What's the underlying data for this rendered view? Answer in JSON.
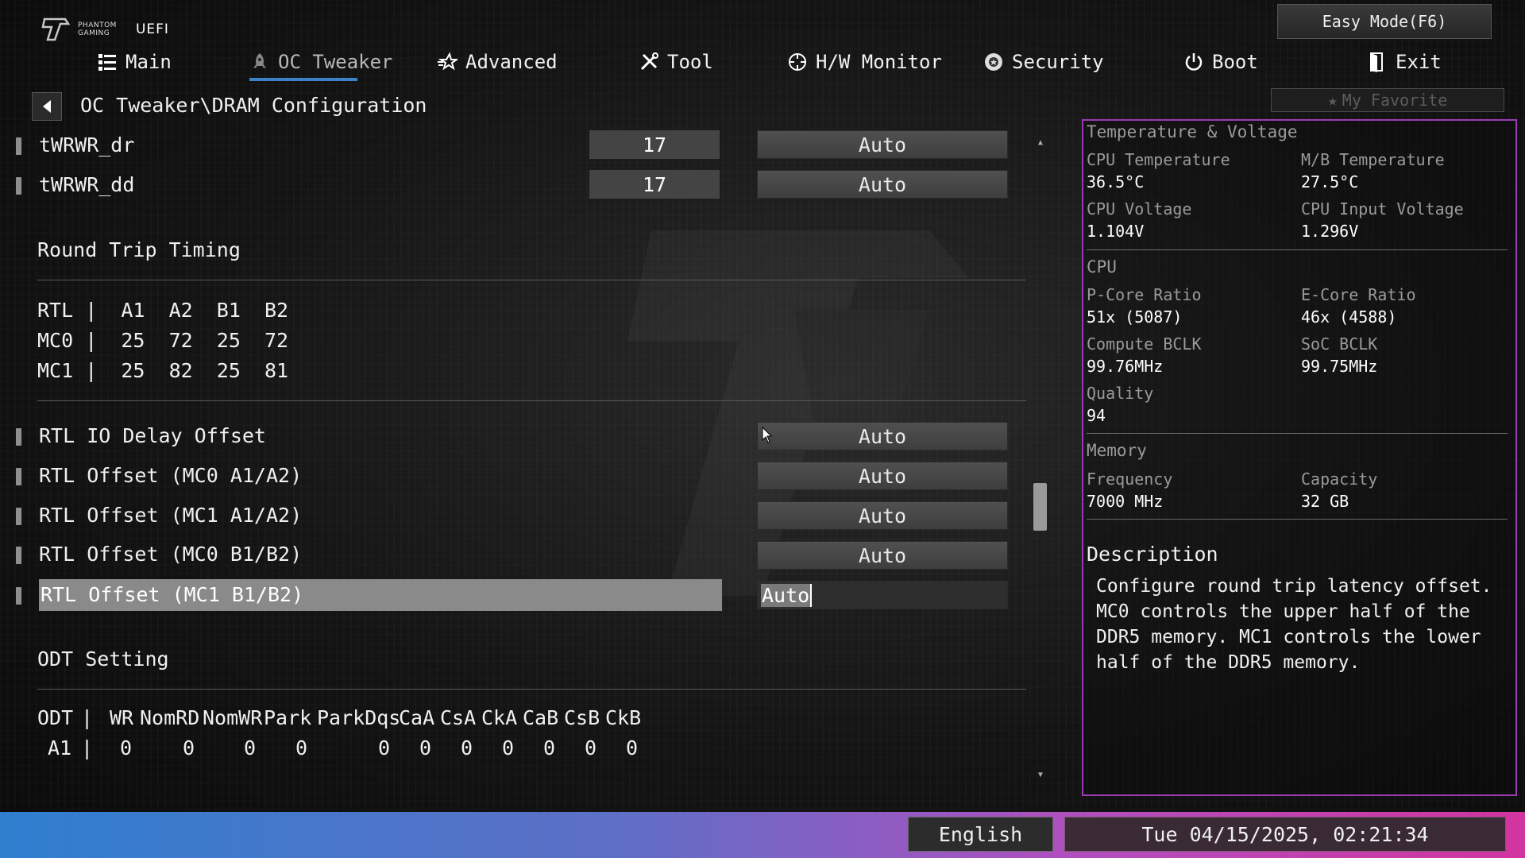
{
  "header": {
    "logo_line1": "PHANTOM",
    "logo_line2": "GAMING",
    "logo_uefi": "UEFI",
    "easy_mode": "Easy Mode(F6)",
    "my_favorite": "My Favorite"
  },
  "nav": [
    {
      "label": "Main",
      "icon": "list-icon"
    },
    {
      "label": "OC Tweaker",
      "icon": "rocket-icon",
      "active": true
    },
    {
      "label": "Advanced",
      "icon": "star-icon"
    },
    {
      "label": "Tool",
      "icon": "tools-icon"
    },
    {
      "label": "H/W Monitor",
      "icon": "monitor-icon"
    },
    {
      "label": "Security",
      "icon": "shield-icon"
    },
    {
      "label": "Boot",
      "icon": "power-icon"
    },
    {
      "label": "Exit",
      "icon": "exit-icon"
    }
  ],
  "breadcrumb": "OC Tweaker\\DRAM Configuration",
  "settings_top": [
    {
      "label": "tWRWR_dr",
      "number": "17",
      "value": "Auto"
    },
    {
      "label": "tWRWR_dd",
      "number": "17",
      "value": "Auto"
    }
  ],
  "round_trip": {
    "title": "Round Trip Timing",
    "lines": [
      "RTL |  A1  A2  B1  B2",
      "MC0 |  25  72  25  72",
      "MC1 |  25  82  25  81"
    ]
  },
  "rtl_settings": [
    {
      "label": "RTL IO Delay Offset",
      "value": "Auto"
    },
    {
      "label": "RTL Offset (MC0 A1/A2)",
      "value": "Auto"
    },
    {
      "label": "RTL Offset (MC1 A1/A2)",
      "value": "Auto"
    },
    {
      "label": "RTL Offset (MC0 B1/B2)",
      "value": "Auto"
    },
    {
      "label": "RTL Offset (MC1 B1/B2)",
      "value": "Auto",
      "selected": true
    }
  ],
  "odt": {
    "title": "ODT Setting",
    "headers": [
      "ODT",
      "|",
      "WR",
      "NomRD",
      "NomWR",
      "Park",
      "ParkDqs",
      "CaA",
      "CsA",
      "CkA",
      "CaB",
      "CsB",
      "CkB"
    ],
    "row": [
      "A1",
      "|",
      "0",
      "0",
      "0",
      "0",
      "0",
      "0",
      "0",
      "0",
      "0",
      "0",
      "0"
    ]
  },
  "hw_monitor": {
    "temp_voltage_title": "Temperature & Voltage",
    "cpu_temp_label": "CPU Temperature",
    "cpu_temp_value": "36.5°C",
    "mb_temp_label": "M/B Temperature",
    "mb_temp_value": "27.5°C",
    "cpu_voltage_label": "CPU Voltage",
    "cpu_voltage_value": "1.104V",
    "cpu_input_voltage_label": "CPU Input Voltage",
    "cpu_input_voltage_value": "1.296V",
    "cpu_title": "CPU",
    "pcore_label": "P-Core Ratio",
    "pcore_value": "51x (5087)",
    "ecore_label": "E-Core Ratio",
    "ecore_value": "46x (4588)",
    "bclk_label": "Compute BCLK",
    "bclk_value": "99.76MHz",
    "soc_label": "SoC BCLK",
    "soc_value": "99.75MHz",
    "quality_label": "Quality",
    "quality_value": "94",
    "memory_title": "Memory",
    "freq_label": "Frequency",
    "freq_value": "7000 MHz",
    "cap_label": "Capacity",
    "cap_value": "32 GB"
  },
  "description": {
    "title": "Description",
    "text": "Configure round trip latency offset. MC0 controls the upper half of the DDR5 memory. MC1 controls the lower half of the DDR5 memory."
  },
  "footer": {
    "language": "English",
    "datetime": "Tue 04/15/2025, 02:21:34"
  },
  "colors": {
    "accent_blue": "#3d82c8",
    "panel_border": "#9a3cb0",
    "footer_start": "#2f7fcf",
    "footer_end": "#d2349f"
  }
}
